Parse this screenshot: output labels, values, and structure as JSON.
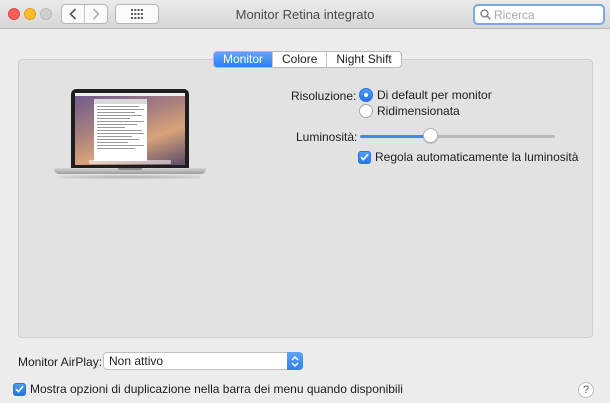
{
  "window": {
    "title": "Monitor Retina integrato",
    "search_placeholder": "Ricerca"
  },
  "tabs": [
    {
      "label": "Monitor",
      "active": true
    },
    {
      "label": "Colore",
      "active": false
    },
    {
      "label": "Night Shift",
      "active": false
    }
  ],
  "resolution": {
    "label": "Risoluzione:",
    "options": [
      {
        "label": "Di default per monitor",
        "selected": true
      },
      {
        "label": "Ridimensionata",
        "selected": false
      }
    ]
  },
  "brightness": {
    "label": "Luminosità:",
    "value_percent": 36,
    "auto_label": "Regola automaticamente la luminosità",
    "auto_checked": true
  },
  "airplay": {
    "label": "Monitor AirPlay:",
    "selected": "Non attivo"
  },
  "mirroring": {
    "label": "Mostra opzioni di duplicazione nella barra dei menu quando disponibili",
    "checked": true
  },
  "help": {
    "label": "?"
  },
  "colors": {
    "accent": "#2e7ff0",
    "close": "#fc5f57",
    "minimize": "#fdbc2e"
  }
}
